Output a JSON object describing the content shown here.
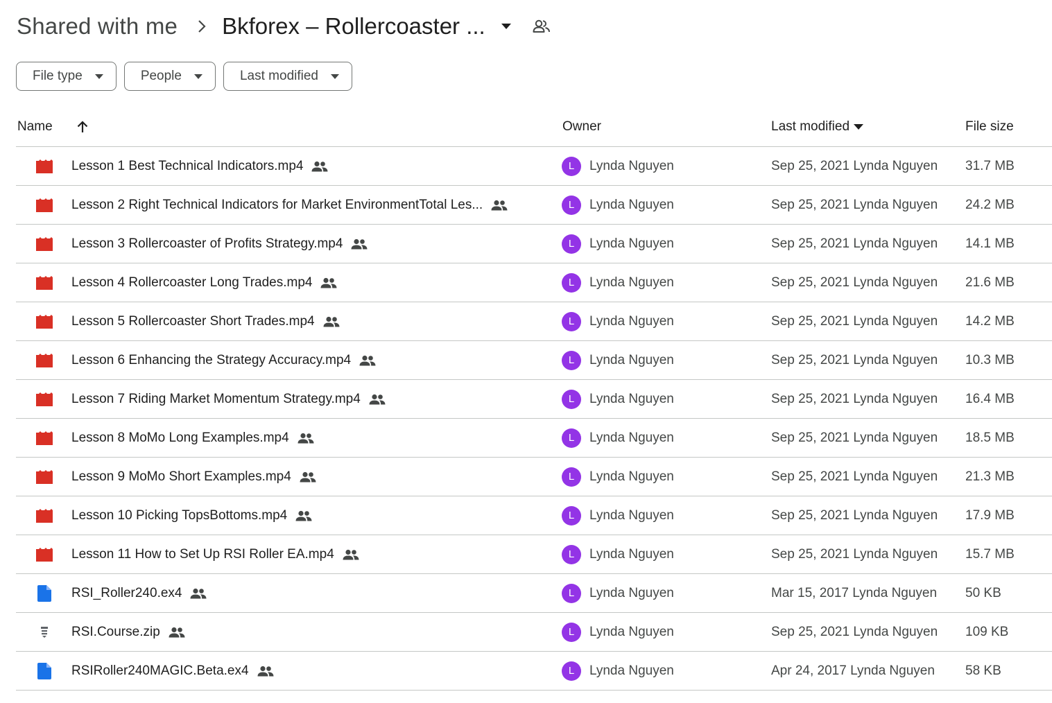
{
  "breadcrumb": {
    "root": "Shared with me",
    "separator_icon": "chevron-right-icon",
    "current": "Bkforex – Rollercoaster ...",
    "caret_icon": "arrow-drop-down-icon",
    "shared_icon": "people-outline-icon"
  },
  "filters": [
    {
      "label": "File type"
    },
    {
      "label": "People"
    },
    {
      "label": "Last modified"
    }
  ],
  "table": {
    "columns": {
      "name": "Name",
      "owner": "Owner",
      "last_modified": "Last modified",
      "file_size": "File size"
    },
    "sort_icon": "arrow-upward-icon",
    "rows": [
      {
        "icon": "video",
        "name": "Lesson 1 Best Technical Indicators.mp4",
        "avatar": "L",
        "owner": "Lynda Nguyen",
        "modified": "Sep 25, 2021 Lynda Nguyen",
        "size": "31.7 MB"
      },
      {
        "icon": "video",
        "name": "Lesson 2 Right Technical Indicators for Market EnvironmentTotal Les...",
        "avatar": "L",
        "owner": "Lynda Nguyen",
        "modified": "Sep 25, 2021 Lynda Nguyen",
        "size": "24.2 MB"
      },
      {
        "icon": "video",
        "name": "Lesson 3 Rollercoaster of Profits Strategy.mp4",
        "avatar": "L",
        "owner": "Lynda Nguyen",
        "modified": "Sep 25, 2021 Lynda Nguyen",
        "size": "14.1 MB"
      },
      {
        "icon": "video",
        "name": "Lesson 4 Rollercoaster Long Trades.mp4",
        "avatar": "L",
        "owner": "Lynda Nguyen",
        "modified": "Sep 25, 2021 Lynda Nguyen",
        "size": "21.6 MB"
      },
      {
        "icon": "video",
        "name": "Lesson 5 Rollercoaster Short Trades.mp4",
        "avatar": "L",
        "owner": "Lynda Nguyen",
        "modified": "Sep 25, 2021 Lynda Nguyen",
        "size": "14.2 MB"
      },
      {
        "icon": "video",
        "name": "Lesson 6 Enhancing the Strategy Accuracy.mp4",
        "avatar": "L",
        "owner": "Lynda Nguyen",
        "modified": "Sep 25, 2021 Lynda Nguyen",
        "size": "10.3 MB"
      },
      {
        "icon": "video",
        "name": "Lesson 7 Riding Market Momentum Strategy.mp4",
        "avatar": "L",
        "owner": "Lynda Nguyen",
        "modified": "Sep 25, 2021 Lynda Nguyen",
        "size": "16.4 MB"
      },
      {
        "icon": "video",
        "name": "Lesson 8 MoMo Long Examples.mp4",
        "avatar": "L",
        "owner": "Lynda Nguyen",
        "modified": "Sep 25, 2021 Lynda Nguyen",
        "size": "18.5 MB"
      },
      {
        "icon": "video",
        "name": "Lesson 9 MoMo Short Examples.mp4",
        "avatar": "L",
        "owner": "Lynda Nguyen",
        "modified": "Sep 25, 2021 Lynda Nguyen",
        "size": "21.3 MB"
      },
      {
        "icon": "video",
        "name": "Lesson 10 Picking TopsBottoms.mp4",
        "avatar": "L",
        "owner": "Lynda Nguyen",
        "modified": "Sep 25, 2021 Lynda Nguyen",
        "size": "17.9 MB"
      },
      {
        "icon": "video",
        "name": "Lesson 11 How to Set Up RSI Roller EA.mp4",
        "avatar": "L",
        "owner": "Lynda Nguyen",
        "modified": "Sep 25, 2021 Lynda Nguyen",
        "size": "15.7 MB"
      },
      {
        "icon": "doc",
        "name": "RSI_Roller240.ex4",
        "avatar": "L",
        "owner": "Lynda Nguyen",
        "modified": "Mar 15, 2017 Lynda Nguyen",
        "size": "50 KB"
      },
      {
        "icon": "zip",
        "name": "RSI.Course.zip",
        "avatar": "L",
        "owner": "Lynda Nguyen",
        "modified": "Sep 25, 2021 Lynda Nguyen",
        "size": "109 KB"
      },
      {
        "icon": "doc",
        "name": "RSIRoller240MAGIC.Beta.ex4",
        "avatar": "L",
        "owner": "Lynda Nguyen",
        "modified": "Apr 24, 2017 Lynda Nguyen",
        "size": "58 KB"
      }
    ]
  },
  "colors": {
    "video_icon": "#d93025",
    "doc_icon": "#1a73e8",
    "zip_icon": "#5f6368",
    "avatar_bg": "#9334e6",
    "divider": "#c4c7c5"
  }
}
